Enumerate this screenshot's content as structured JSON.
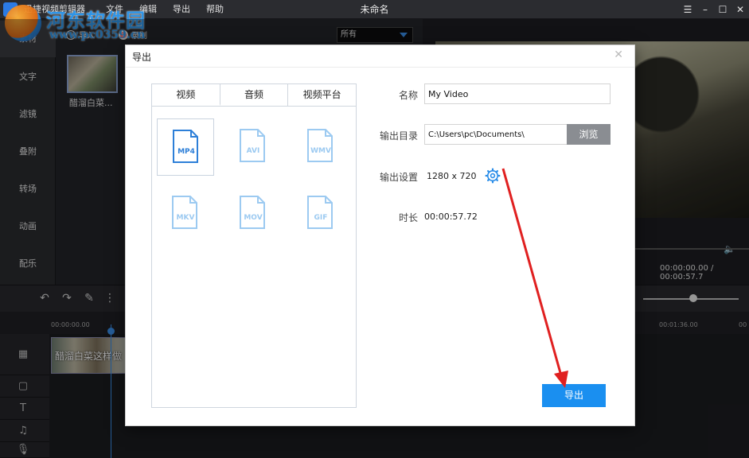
{
  "window": {
    "app_name": "迅捷视频剪辑器",
    "title": "未命名",
    "menu": [
      "文件",
      "编辑",
      "导出",
      "帮助"
    ],
    "controls": [
      "menu-icon",
      "minimize-icon",
      "maximize-icon",
      "close-icon"
    ]
  },
  "watermark": {
    "title": "河东软件园",
    "url": "www.pc0359.cn"
  },
  "sidenav": {
    "items": [
      "素材",
      "文字",
      "滤镜",
      "叠附",
      "转场",
      "动画",
      "配乐"
    ],
    "active": "素材"
  },
  "media": {
    "import_label": "导入",
    "record_label": "录制",
    "filter_value": "所有",
    "items": [
      {
        "caption": "醋溜白菜..."
      }
    ]
  },
  "preview": {
    "time": "00:00:00.00 / 00:00:57.7"
  },
  "timeline": {
    "ruler": [
      "00:00:00.00",
      "00:01:36.00",
      "00"
    ],
    "clip_label": "醋溜白菜这样做"
  },
  "dialog": {
    "title": "导出",
    "tabs": [
      "视频",
      "音频",
      "视频平台"
    ],
    "active_tab": "视频",
    "formats": [
      {
        "label": "MP4",
        "selected": true
      },
      {
        "label": "AVI",
        "selected": false
      },
      {
        "label": "WMV",
        "selected": false
      },
      {
        "label": "MKV",
        "selected": false
      },
      {
        "label": "MOV",
        "selected": false
      },
      {
        "label": "GIF",
        "selected": false
      }
    ],
    "name_label": "名称",
    "name_value": "My Video",
    "dir_label": "输出目录",
    "dir_value": "C:\\Users\\pc\\Documents\\",
    "browse_label": "浏览",
    "settings_label": "输出设置",
    "settings_value": "1280 x 720",
    "duration_label": "时长",
    "duration_value": "00:00:57.72",
    "export_label": "导出"
  },
  "colors": {
    "accent": "#1a8ff0",
    "format_selected": "#2d7fd8",
    "format_idle": "#9ccaf1",
    "annotation_arrow": "#e02020"
  }
}
